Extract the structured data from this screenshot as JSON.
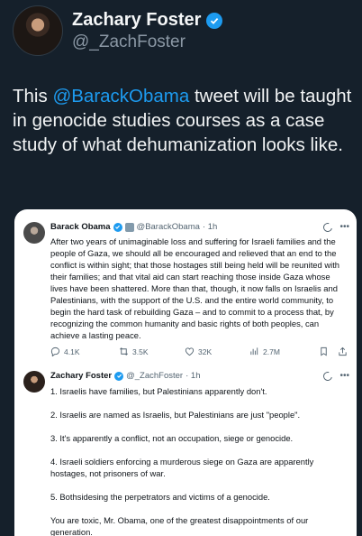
{
  "header": {
    "name": "Zachary Foster",
    "handle": "@_ZachFoster"
  },
  "tweet": {
    "text_before": "This ",
    "mention": "@BarackObama",
    "text_after": " tweet will be taught in genocide studies courses as a case study of what dehumanization looks like."
  },
  "quoted": {
    "name": "Barack Obama",
    "handle": "@BarackObama",
    "time": "· 1h",
    "text": "After two years of unimaginable loss and suffering for Israeli families and the people of Gaza, we should all be encouraged and relieved that an end to the conflict is within sight; that those hostages still being held will be reunited with their families; and that vital aid can start reaching those inside Gaza whose lives have been shattered. More than that, though, it now falls on Israelis and Palestinians, with the support of the U.S. and the entire world community, to begin the hard task of rebuilding Gaza – and to commit to a process that, by recognizing the common humanity and basic rights of both peoples, can achieve a lasting peace.",
    "replies": "4.1K",
    "reposts": "3.5K",
    "likes": "32K",
    "views": "2.7M"
  },
  "reply": {
    "name": "Zachary Foster",
    "handle": "@_ZachFoster",
    "time": "· 1h",
    "items": [
      "1. Israelis have families, but Palestinians apparently don't.",
      "2. Israelis are named as Israelis, but Palestinians are just \"people\".",
      "3. It's apparently a conflict, not an occupation, siege or genocide.",
      "4. Israeli soldiers enforcing a murderous siege on Gaza are apparently hostages, not prisoners of war.",
      "5. Bothsidesing the perpetrators and victims of a genocide.",
      "You are toxic, Mr. Obama, one of the greatest disappointments of our generation."
    ]
  },
  "icons": [
    "verified-badge-icon",
    "government-seal-icon",
    "grok-icon",
    "more-icon",
    "reply-icon",
    "repost-icon",
    "like-icon",
    "views-icon",
    "bookmark-icon",
    "share-icon"
  ],
  "colors": {
    "background": "#15202b",
    "accent": "#1d9bf0",
    "muted": "#8b98a5"
  }
}
